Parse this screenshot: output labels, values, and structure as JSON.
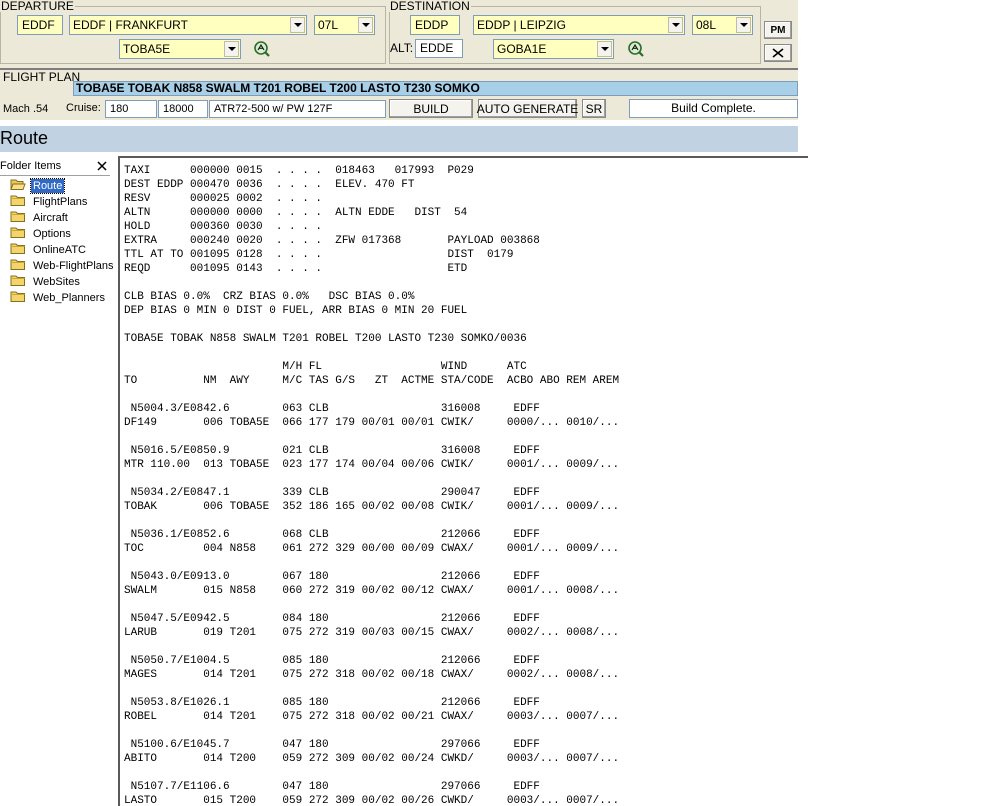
{
  "departure": {
    "legend": "DEPARTURE",
    "icao": "EDDF",
    "airport": "EDDF | FRANKFURT",
    "runway": "07L",
    "sid": "TOBA5E"
  },
  "destination": {
    "legend": "DESTINATION",
    "icao": "EDDP",
    "airport": "EDDP | LEIPZIG",
    "runway": "08L",
    "star": "GOBA1E",
    "alt_label": "ALT:",
    "alt_value": "EDDE"
  },
  "buttons": {
    "pm": "PM",
    "build": "BUILD",
    "auto_generate": "AUTO GENERATE",
    "sr": "SR"
  },
  "flight_plan": {
    "label": "FLIGHT PLAN",
    "route": "TOBA5E TOBAK N858 SWALM T201 ROBEL T200 LASTO T230 SOMKO"
  },
  "cruise": {
    "mach": "Mach .54",
    "cruise_label": "Cruise:",
    "fl": "180",
    "alt": "18000",
    "aircraft": "ATR72-500 w/ PW 127F",
    "status": "Build Complete."
  },
  "section_title": "Route",
  "folder_panel": {
    "title": "Folder Items",
    "items": [
      "Route",
      "FlightPlans",
      "Aircraft",
      "Options",
      "OnlineATC",
      "Web-FlightPlans",
      "WebSites",
      "Web_Planners"
    ]
  },
  "report_lines": [
    "TAXI      000000 0015  . . . .  018463   017993  P029",
    "DEST EDDP 000470 0036  . . . .  ELEV. 470 FT",
    "RESV      000025 0002  . . . .",
    "ALTN      000000 0000  . . . .  ALTN EDDE   DIST  54",
    "HOLD      000360 0030  . . . .",
    "EXTRA     000240 0020  . . . .  ZFW 017368       PAYLOAD 003868",
    "TTL AT TO 001095 0128  . . . .                   DIST  0179",
    "REQD      001095 0143  . . . .                   ETD",
    "",
    "CLB BIAS 0.0%  CRZ BIAS 0.0%   DSC BIAS 0.0%",
    "DEP BIAS 0 MIN 0 DIST 0 FUEL, ARR BIAS 0 MIN 20 FUEL",
    "",
    "TOBA5E TOBAK N858 SWALM T201 ROBEL T200 LASTO T230 SOMKO/0036",
    "",
    "                        M/H FL                  WIND      ATC",
    "TO          NM  AWY     M/C TAS G/S   ZT  ACTME STA/CODE  ACBO ABO REM AREM",
    "",
    " N5004.3/E0842.6        063 CLB                 316008     EDFF",
    "DF149       006 TOBA5E  066 177 179 00/01 00/01 CWIK/     0000/... 0010/...",
    "",
    " N5016.5/E0850.9        021 CLB                 316008     EDFF",
    "MTR 110.00  013 TOBA5E  023 177 174 00/04 00/06 CWIK/     0001/... 0009/...",
    "",
    " N5034.2/E0847.1        339 CLB                 290047     EDFF",
    "TOBAK       006 TOBA5E  352 186 165 00/02 00/08 CWIK/     0001/... 0009/...",
    "",
    " N5036.1/E0852.6        068 CLB                 212066     EDFF",
    "TOC         004 N858    061 272 329 00/00 00/09 CWAX/     0001/... 0009/...",
    "",
    " N5043.0/E0913.0        067 180                 212066     EDFF",
    "SWALM       015 N858    060 272 319 00/02 00/12 CWAX/     0001/... 0008/...",
    "",
    " N5047.5/E0942.5        084 180                 212066     EDFF",
    "LARUB       019 T201    075 272 319 00/03 00/15 CWAX/     0002/... 0008/...",
    "",
    " N5050.7/E1004.5        085 180                 212066     EDFF",
    "MAGES       014 T201    075 272 318 00/02 00/18 CWAX/     0002/... 0008/...",
    "",
    " N5053.8/E1026.1        085 180                 212066     EDFF",
    "ROBEL       014 T201    075 272 318 00/02 00/21 CWAX/     0003/... 0007/...",
    "",
    " N5100.6/E1045.7        047 180                 297066     EDFF",
    "ABITO       014 T200    059 272 309 00/02 00/24 CWKD/     0003/... 0007/...",
    "",
    " N5107.7/E1106.6        047 180                 297066     EDFF",
    "LASTO       015 T200    059 272 309 00/02 00/26 CWKD/     0003/... 0007/..."
  ]
}
